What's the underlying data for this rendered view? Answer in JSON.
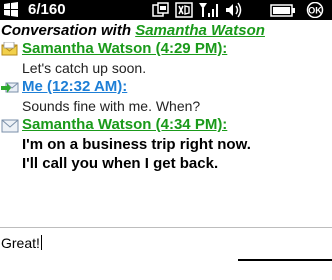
{
  "status_bar": {
    "counter": "6/160",
    "icons": [
      "start-icon",
      "sync-icon",
      "data-icon",
      "signal-icon",
      "volume-icon",
      "battery-icon",
      "ok-icon"
    ]
  },
  "conversation": {
    "title_prefix": "Conversation with ",
    "contact_name": "Samantha Watson",
    "messages": [
      {
        "sender": "Samantha Watson (4:29 PM):",
        "body": [
          "Let's catch up soon."
        ],
        "icon": "received-envelope-icon",
        "sender_color": "#1a9a1a",
        "bold": false
      },
      {
        "sender": "Me (12:32 AM):",
        "body": [
          "Sounds fine with me. When?"
        ],
        "icon": "sent-envelope-icon",
        "sender_color": "#1e7fd6",
        "bold": false
      },
      {
        "sender": "Samantha Watson (4:34 PM):",
        "body": [
          "I'm on a business trip right now.",
          "I'll call you when I get back."
        ],
        "icon": "new-message-icon",
        "sender_color": "#1a9a1a",
        "bold": true
      }
    ]
  },
  "compose": {
    "value": "Great!"
  }
}
